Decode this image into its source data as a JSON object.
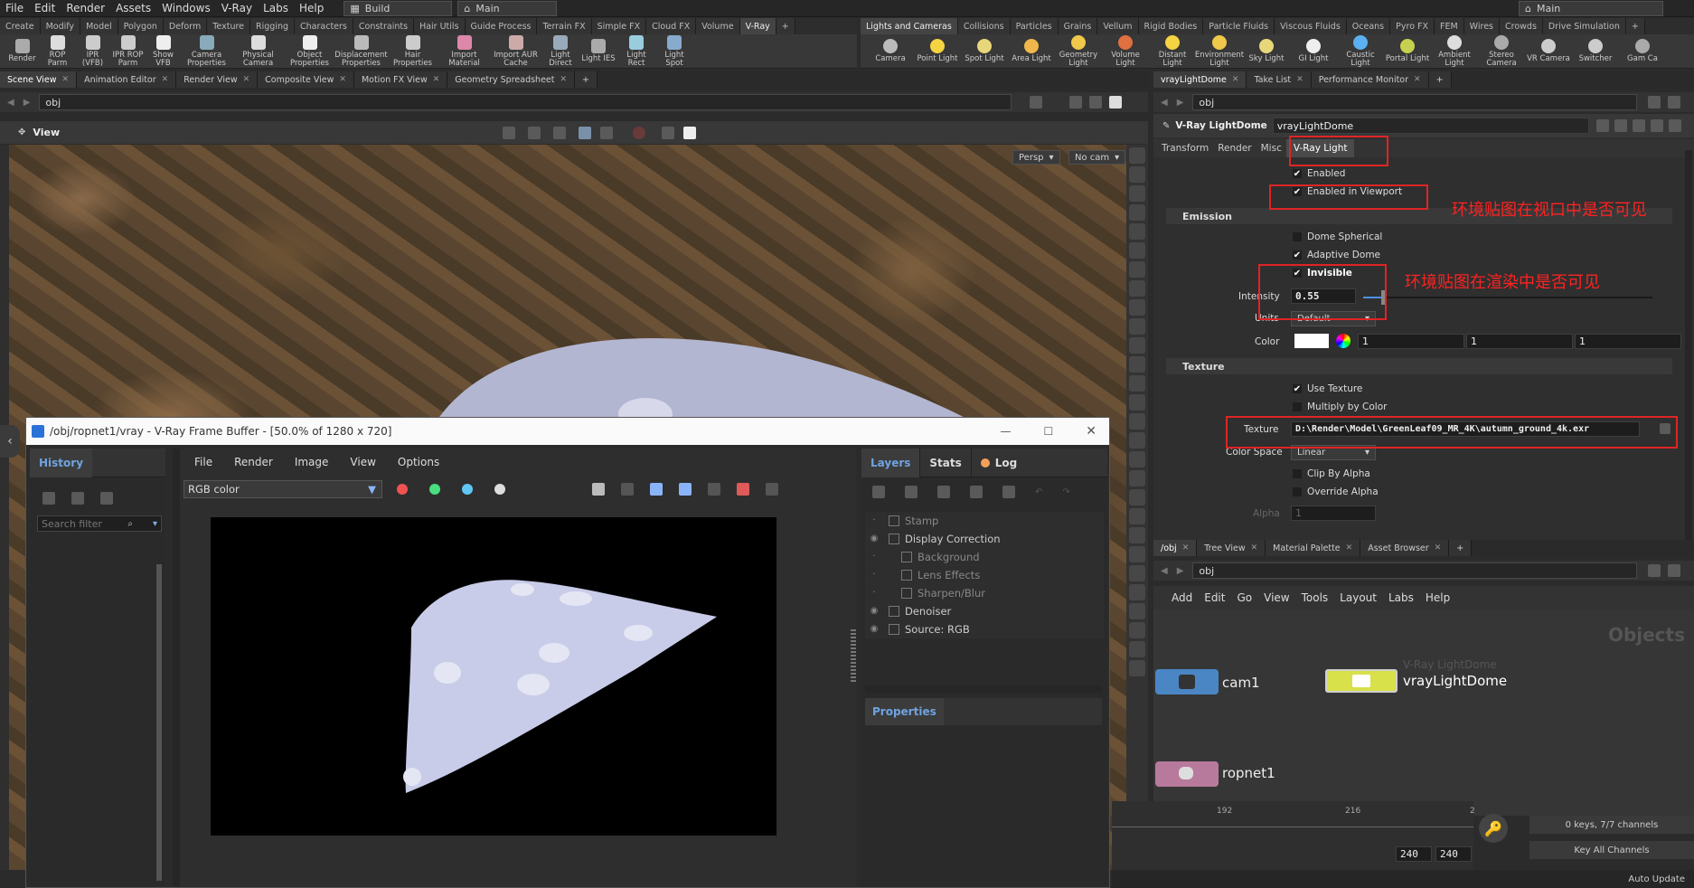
{
  "menubar": {
    "items": [
      "File",
      "Edit",
      "Render",
      "Assets",
      "Windows",
      "V-Ray",
      "Labs",
      "Help"
    ],
    "desktop": "Build",
    "context": "Main",
    "context_right": "Main"
  },
  "shelf_tabs_left": [
    "Create",
    "Modify",
    "Model",
    "Polygon",
    "Deform",
    "Texture",
    "Rigging",
    "Characters",
    "Constraints",
    "Hair Utils",
    "Guide Process",
    "Terrain FX",
    "Simple FX",
    "Cloud FX",
    "Volume",
    "V-Ray"
  ],
  "shelf_tools_left": [
    "Render",
    "ROP Parm",
    "IPR (VFB)",
    "IPR ROP Parm",
    "Show VFB",
    "Camera Properties",
    "Physical Camera",
    "Object Properties",
    "Displacement Properties",
    "Hair Properties",
    "Import Material",
    "Import AUR Cache",
    "Light Direct",
    "Light IES",
    "Light Rect",
    "Light Spot"
  ],
  "shelf_tabs_right": [
    "Lights and Cameras",
    "Collisions",
    "Particles",
    "Grains",
    "Vellum",
    "Rigid Bodies",
    "Particle Fluids",
    "Viscous Fluids",
    "Oceans",
    "Pyro FX",
    "FEM",
    "Wires",
    "Crowds",
    "Drive Simulation"
  ],
  "shelf_tools_right": [
    "Camera",
    "Point Light",
    "Spot Light",
    "Area Light",
    "Geometry Light",
    "Volume Light",
    "Distant Light",
    "Environment Light",
    "Sky Light",
    "GI Light",
    "Caustic Light",
    "Portal Light",
    "Ambient Light",
    "Stereo Camera",
    "VR Camera",
    "Switcher",
    "Gam Ca"
  ],
  "viewer": {
    "tabs": [
      "Scene View",
      "Animation Editor",
      "Render View",
      "Composite View",
      "Motion FX View",
      "Geometry Spreadsheet"
    ],
    "path": "obj",
    "title": "View",
    "persp": "Persp",
    "cam": "No cam"
  },
  "params": {
    "tabs": [
      "vrayLightDome",
      "Take List",
      "Performance Monitor"
    ],
    "path": "obj",
    "node_type": "V-Ray LightDome",
    "node_name": "vrayLightDome",
    "subtabs": [
      "Transform",
      "Render",
      "Misc",
      "V-Ray Light"
    ],
    "enabled": "Enabled",
    "enabled_viewport": "Enabled in Viewport",
    "emission": "Emission",
    "dome_spherical": "Dome Spherical",
    "adaptive_dome": "Adaptive Dome",
    "invisible": "Invisible",
    "intensity_label": "Intensity",
    "intensity": "0.55",
    "units_label": "Units",
    "units": "Default",
    "color_label": "Color",
    "color_r": "1",
    "color_g": "1",
    "color_b": "1",
    "texture_section": "Texture",
    "use_texture": "Use Texture",
    "multiply_by_color": "Multiply by Color",
    "texture_label": "Texture",
    "texture_path": "D:\\Render\\Model\\GreenLeaf09_MR_4K\\autumn_ground_4k.exr",
    "color_space_label": "Color Space",
    "color_space": "Linear",
    "clip_by_alpha": "Clip By Alpha",
    "override_alpha": "Override Alpha",
    "alpha_label": "Alpha",
    "alpha": "1"
  },
  "annotations": {
    "viewport": "环境贴图在视口中是否可见",
    "render": "环境贴图在渲染中是否可见"
  },
  "network": {
    "tabs": [
      "/obj",
      "Tree View",
      "Material Palette",
      "Asset Browser"
    ],
    "path": "obj",
    "menu": [
      "Add",
      "Edit",
      "Go",
      "View",
      "Tools",
      "Layout",
      "Labs",
      "Help"
    ],
    "watermark": "Objects",
    "nodes": {
      "cam": "cam1",
      "dome_type": "V-Ray LightDome",
      "dome": "vrayLightDome",
      "rop": "ropnet1"
    }
  },
  "vfb": {
    "title": "/obj/ropnet1/vray - V-Ray Frame Buffer - [50.0% of 1280 x 720]",
    "history": "History",
    "search": "Search filter",
    "menu": [
      "File",
      "Render",
      "Image",
      "View",
      "Options"
    ],
    "channel": "RGB color",
    "tabs": [
      "Layers",
      "Stats",
      "Log"
    ],
    "layers": [
      "Stamp",
      "Display Correction",
      "Background",
      "Lens Effects",
      "Sharpen/Blur",
      "Denoiser",
      "Source: RGB"
    ],
    "properties": "Properties"
  },
  "timeline": {
    "ticks": [
      "192",
      "216",
      "2"
    ],
    "frame_a": "240",
    "frame_b": "240",
    "keys": "0 keys, 7/7 channels",
    "key_all": "Key All Channels",
    "auto_update": "Auto Update"
  }
}
